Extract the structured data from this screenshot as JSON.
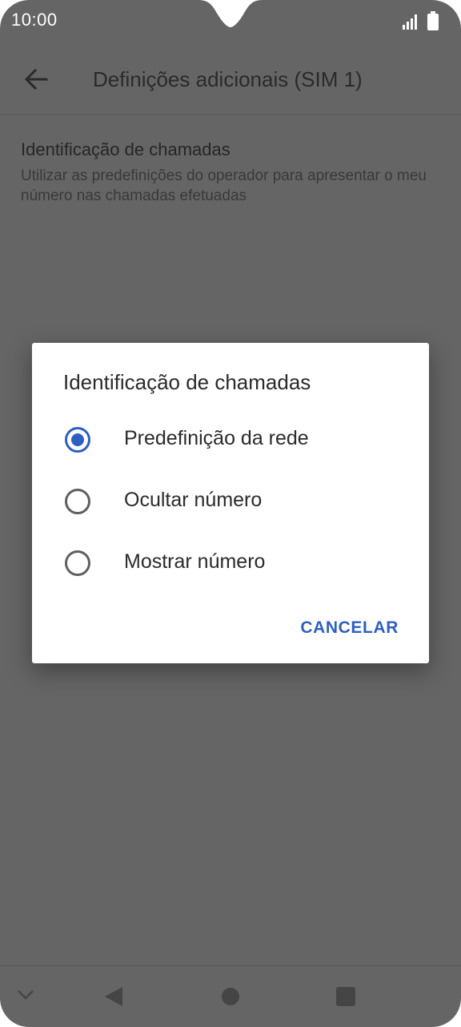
{
  "status_bar": {
    "time": "10:00",
    "icons": [
      "signal-icon",
      "battery-icon"
    ]
  },
  "app_bar": {
    "back_icon": "arrow-back-icon",
    "title": "Definições adicionais (SIM 1)"
  },
  "preference": {
    "title": "Identificação de chamadas",
    "summary": "Utilizar as predefinições do operador para apresentar o meu número nas chamadas efetuadas"
  },
  "dialog": {
    "title": "Identificação de chamadas",
    "options": [
      {
        "label": "Predefinição da rede",
        "selected": true
      },
      {
        "label": "Ocultar número",
        "selected": false
      },
      {
        "label": "Mostrar número",
        "selected": false
      }
    ],
    "cancel_label": "CANCELAR",
    "accent_color": "#2f5fbf"
  },
  "nav_bar": {
    "icons": [
      "chevron-down-icon",
      "back-triangle-icon",
      "home-circle-icon",
      "recents-square-icon"
    ]
  },
  "colors": {
    "scrim_background": "#656565",
    "dialog_background": "#ffffff",
    "accent": "#2f5fbf"
  }
}
